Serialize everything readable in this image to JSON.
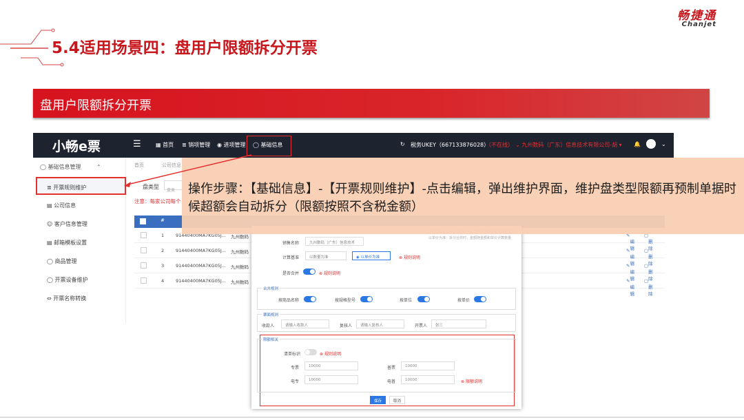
{
  "logo": {
    "cn": "畅捷通",
    "en": "Chanjet"
  },
  "page_title": "5.4适用场景四：盘用户限额拆分开票",
  "banner": "盘用户限额拆分开票",
  "app": {
    "brand": "小畅e票",
    "nav": [
      "首页",
      "销项管理",
      "进项管理",
      "基础信息"
    ],
    "ukey": "税务UKEY（667133876028）",
    "status": "（不在线）",
    "company": "九州数码（广东）信息技术有限公司-胡",
    "sidebar_head": "基础信息管理",
    "sidebar": [
      "开票规则维护",
      "公司信息",
      "客户信息管理",
      "邮箱模板设置",
      "商品管理",
      "开票设备维护",
      "开票名称转换"
    ],
    "tabs": [
      "首页",
      "公司信息"
    ],
    "filter_label": "盘类型",
    "filter_value": "盘类",
    "note": "注意：每家公司每个",
    "rows": [
      {
        "idx": "1",
        "tax": "91440400MA7KG05J...",
        "name": "九州数码",
        "op1": "编辑",
        "op2": "删除"
      },
      {
        "idx": "2",
        "tax": "91440400MA7KG05J...",
        "name": "九州数码",
        "op1": "编辑",
        "op2": "删除"
      },
      {
        "idx": "3",
        "tax": "91440400MA7KG05J...",
        "name": "九州数码",
        "op1": "编辑",
        "op2": "删除"
      },
      {
        "idx": "4",
        "tax": "91440400MA7KG05J...",
        "name": "九州数码",
        "op1": "编辑",
        "op2": "删除"
      }
    ]
  },
  "dialog": {
    "seller_label": "销售名称",
    "seller_value": "九州数码（广东）信息技术",
    "calc_label": "计算基准",
    "calc_opt1": "以数量为准",
    "calc_opt2": "以单价为准",
    "rule_link": "规则说明",
    "merge_label": "是否合并",
    "merge_link": "规则说明",
    "hint": "以数量为准：拆分合并时，金额随金额变化数量计算单价 以单价为准：拆分合并时，金额随金额和单价计算数量",
    "sec_merge": "合并规则",
    "merge_opts": [
      "按商品名称",
      "按规格型号",
      "按单位",
      "按单价"
    ],
    "sec_people": "票面规则",
    "receiver_label": "收款人",
    "receiver_ph": "请输入收款人",
    "checker_label": "复核人",
    "checker_ph": "请输入复核人",
    "drawer_label": "开票人",
    "drawer_value": "张三",
    "sec_limit": "限额相关",
    "list_label": "清单标识",
    "list_link": "规则说明",
    "zhuan_label": "专票",
    "zhuan_value": "10000",
    "pu_label": "普票",
    "pu_value": "10000",
    "dianzhuan_label": "电专",
    "dianzhuan_value": "10000",
    "dianpu_label": "电普",
    "dianpu_value": "10000",
    "limit_link": "限额说明",
    "save": "保存",
    "cancel": "取消"
  },
  "callout": "操作步骤：【基础信息】-【开票规则维护】-点击编辑，弹出维护界面，维护盘类型限额再预制单据时候超额会自动拆分（限额按照不含税金额）"
}
